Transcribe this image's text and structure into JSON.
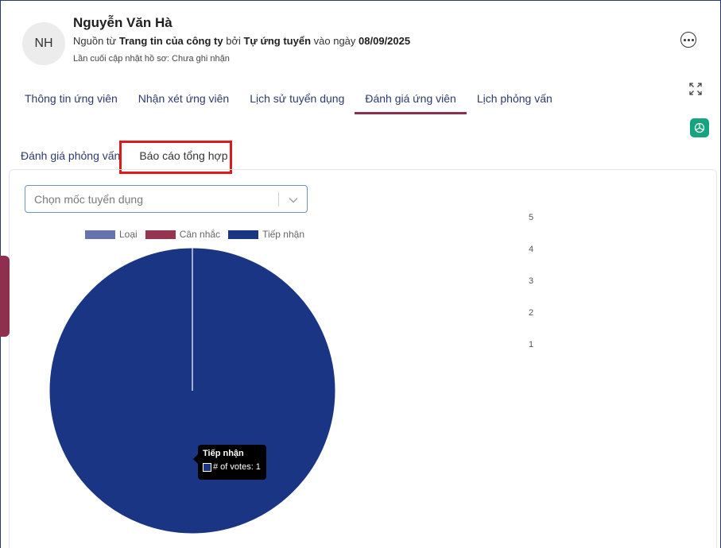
{
  "candidate": {
    "initials": "NH",
    "name": "Nguyễn Văn Hà",
    "source_prefix": "Nguồn từ ",
    "source_name": "Trang tin của công ty",
    "by_text": " bởi ",
    "channel": "Tự ứng tuyển",
    "date_prefix": " vào ngày ",
    "date": "08/09/2025",
    "last_updated": "Lần cuối cập nhật hồ sơ: Chưa ghi nhận"
  },
  "tabs": [
    {
      "label": "Thông tin ứng viên"
    },
    {
      "label": "Nhận xét ứng viên"
    },
    {
      "label": "Lịch sử tuyển dụng"
    },
    {
      "label": "Đánh giá ứng viên"
    },
    {
      "label": "Lịch phỏng vấn"
    }
  ],
  "active_tab_index": 3,
  "subtabs": [
    {
      "label": "Đánh giá phỏng vấn"
    },
    {
      "label": "Báo cáo tổng hợp"
    }
  ],
  "select": {
    "placeholder": "Chọn mốc tuyển dụng"
  },
  "colors": {
    "accent": "#8e2f4d",
    "tab_text": "#2d3b6e",
    "highlight": "#e01818",
    "loai": "#6574ae",
    "can_nhac": "#97344f",
    "tiep_nhan": "#1a3584",
    "chatgpt": "#16a37f"
  },
  "chart_data": {
    "type": "pie",
    "legend": [
      "Loại",
      "Cân nhắc",
      "Tiếp nhận"
    ],
    "legend_position": "top",
    "slices": [
      {
        "name": "Loại",
        "value": 0
      },
      {
        "name": "Cân nhắc",
        "value": 0
      },
      {
        "name": "Tiếp nhận",
        "value": 1
      }
    ],
    "tooltip": {
      "title": "Tiếp nhận",
      "label": "# of votes: 1"
    },
    "y_ticks": [
      "5",
      "4",
      "3",
      "2",
      "1"
    ]
  }
}
